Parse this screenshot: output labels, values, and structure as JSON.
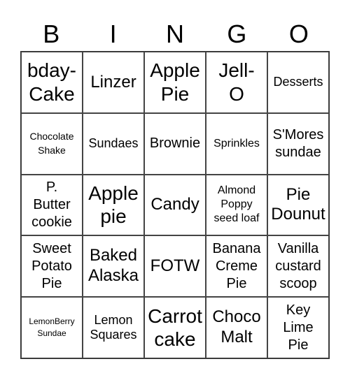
{
  "header": [
    "B",
    "I",
    "N",
    "G",
    "O"
  ],
  "cells": [
    {
      "text": "bday-\nCake",
      "size": "s-xl"
    },
    {
      "text": "Linzer",
      "size": "s-l"
    },
    {
      "text": "Apple\nPie",
      "size": "s-xl"
    },
    {
      "text": "Jell-\nO",
      "size": "s-xl"
    },
    {
      "text": "Desserts",
      "size": "s-s"
    },
    {
      "text": "Chocolate\nShake",
      "size": "s-xxs"
    },
    {
      "text": "Sundaes",
      "size": "s-s"
    },
    {
      "text": "Brownie",
      "size": "s-m"
    },
    {
      "text": "Sprinkles",
      "size": "s-xs"
    },
    {
      "text": "S'Mores\nsundae",
      "size": "s-m"
    },
    {
      "text": "P.\nButter\ncookie",
      "size": "s-m"
    },
    {
      "text": "Apple\npie",
      "size": "s-xl"
    },
    {
      "text": "Candy",
      "size": "s-l"
    },
    {
      "text": "Almond\nPoppy\nseed loaf",
      "size": "s-xs"
    },
    {
      "text": "Pie\nDounut",
      "size": "s-l"
    },
    {
      "text": "Sweet\nPotato\nPie",
      "size": "s-m"
    },
    {
      "text": "Baked\nAlaska",
      "size": "s-l"
    },
    {
      "text": "FOTW",
      "size": "s-l"
    },
    {
      "text": "Banana\nCreme\nPie",
      "size": "s-m"
    },
    {
      "text": "Vanilla\ncustard\nscoop",
      "size": "s-m"
    },
    {
      "text": "LemonBerry\nSundae",
      "size": "s-tiny"
    },
    {
      "text": "Lemon\nSquares",
      "size": "s-s"
    },
    {
      "text": "Carrot\ncake",
      "size": "s-xl"
    },
    {
      "text": "Choco\nMalt",
      "size": "s-l"
    },
    {
      "text": "Key\nLime\nPie",
      "size": "s-m"
    }
  ]
}
